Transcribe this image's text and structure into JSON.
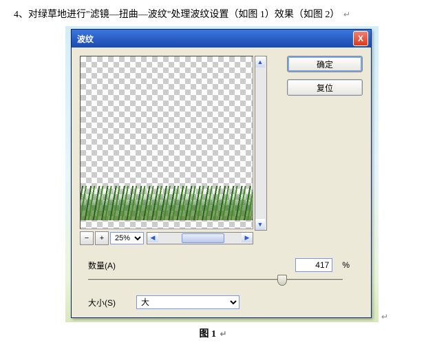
{
  "caption_top": "4、对绿草地进行\"滤镜—扭曲—波纹\"处理波纹设置（如图 1）效果（如图 2）",
  "caption_bottom": "图 1",
  "return_mark": "↵",
  "dialog": {
    "title": "波纹",
    "close": "X",
    "ok_label": "确定",
    "reset_label": "复位",
    "zoom": {
      "minus": "−",
      "plus": "+",
      "value": "25%"
    },
    "amount": {
      "label": "数量(A)",
      "value": "417",
      "unit": "%"
    },
    "size": {
      "label": "大小(S)",
      "value": "大"
    }
  }
}
